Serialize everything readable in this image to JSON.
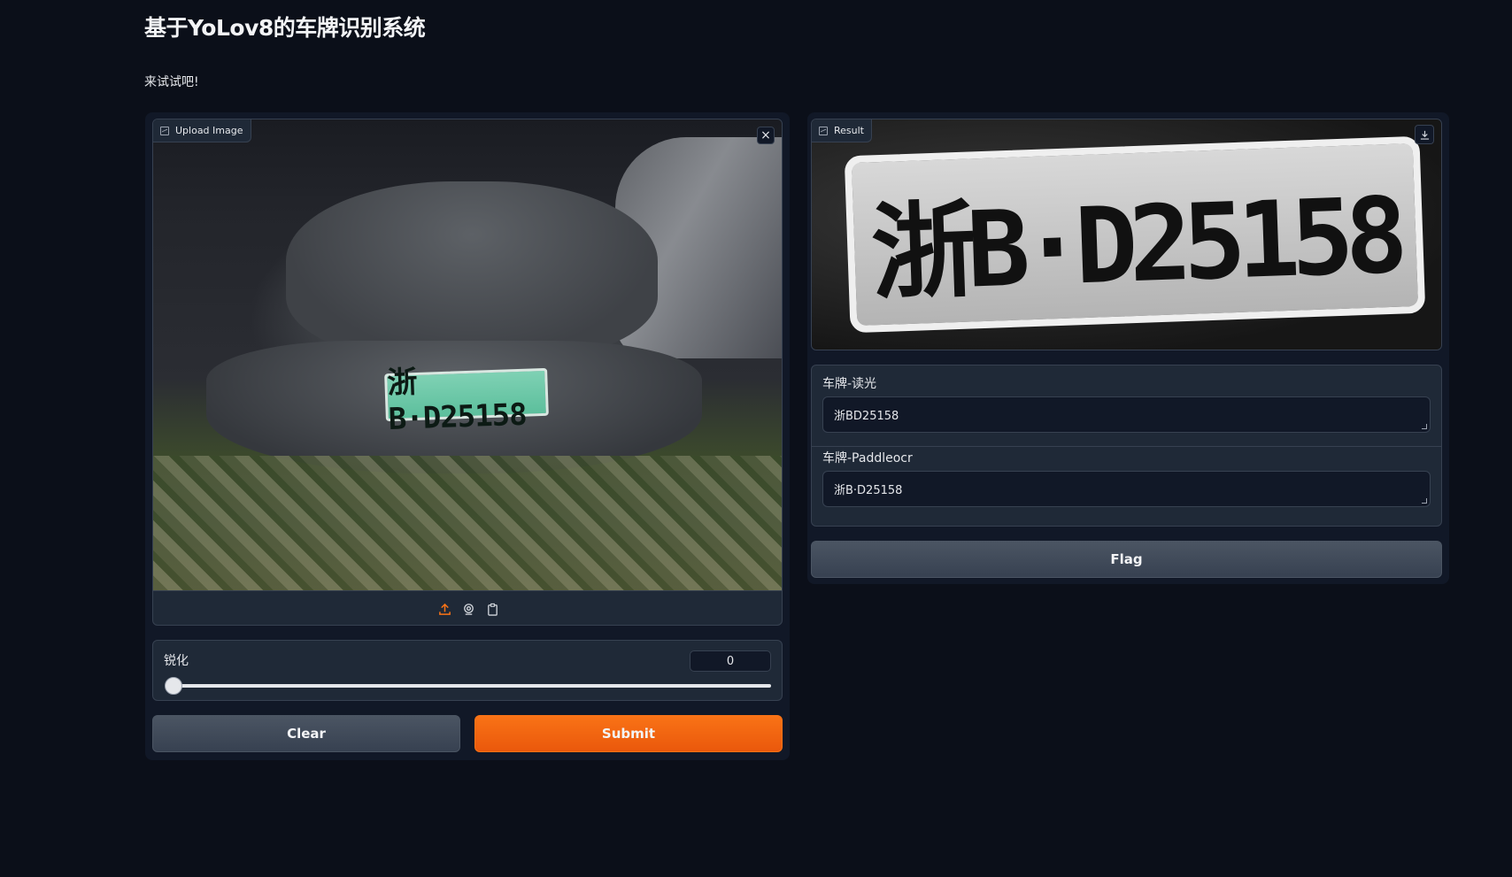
{
  "header": {
    "title": "基于YoLov8的车牌识别系统",
    "description": "来试试吧!"
  },
  "input_panel": {
    "image_label": "Upload Image",
    "image_plate_text": "浙B·D25158",
    "close_icon": "close-icon",
    "sources": [
      "upload-icon",
      "webcam-icon",
      "clipboard-icon"
    ],
    "slider": {
      "label": "锐化",
      "value": "0",
      "fraction": 0.0
    },
    "clear_label": "Clear",
    "submit_label": "Submit"
  },
  "output_panel": {
    "result_label": "Result",
    "result_plate_text": "浙B·D25158",
    "download_icon": "download-icon",
    "field1": {
      "label": "车牌-读光",
      "value": "浙BD25158"
    },
    "field2": {
      "label": "车牌-Paddleocr",
      "value": "浙B·D25158"
    },
    "flag_label": "Flag"
  },
  "colors": {
    "background": "#0b0f19",
    "panel": "#111827",
    "block": "#1f2937",
    "border": "#374151",
    "accent": "#f97316"
  }
}
